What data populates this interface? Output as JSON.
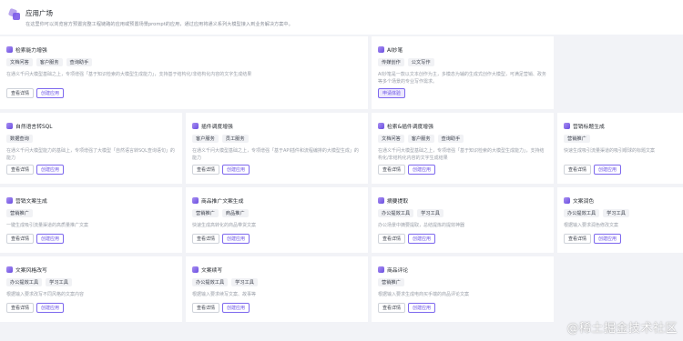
{
  "header": {
    "title": "应用广场",
    "description": "在这里你可以浏览官方预置完整工程链路的应用或预置场景prompt的应用，通过应用将通义系列大模型接入到业务解决方案中。"
  },
  "cards": [
    {
      "name": "检索能力增强",
      "tags": [
        "文档问答",
        "客户服务",
        "查询助手"
      ],
      "desc": "在通义千问大模型基础之上，专项增强「基于知识检索的大模型生成能力」，支持基于结构化/非结构化内容的文字生成结果",
      "view": "查看详情",
      "create": "创建应用"
    },
    {
      "name": "AI妙笔",
      "tags": [
        "传媒创作",
        "公文写作"
      ],
      "desc": "AI妙笔是一款以文本创作为主，多模态为辅的生成式创作大模型，可满足营销、政务等多个场景的专业写作需求。",
      "create": "申请体验"
    },
    {
      "name": "自然语言转SQL",
      "tags": [
        "数据查询"
      ],
      "desc": "在通义千问大模型能力的基础上，专项增强了大模型「自然语言转SQL查询语句」的能力",
      "view": "查看详情",
      "create": "创建应用"
    },
    {
      "name": "插件调度增强",
      "tags": [
        "客户服务",
        "员工服务"
      ],
      "desc": "在通义千问大模型基础之上，专项增强「基于API插件和流程编排的大模型生成」的能力",
      "view": "查看详情",
      "create": "创建应用"
    },
    {
      "name": "检索&插件调度增强",
      "tags": [
        "文档问答",
        "客户服务",
        "查询助手"
      ],
      "desc": "在通义千问大模型基础之上，专项增强「基于知识检索的大模型生成能力」，支持结构化/非结构化内容的文字生成结果",
      "view": "查看详情",
      "create": "创建应用"
    },
    {
      "name": "营销标题生成",
      "tags": [
        "营销推广"
      ],
      "desc": "快速生成吸引流量渠道的吸引眼球的标题文案",
      "view": "查看详情",
      "create": "创建应用"
    },
    {
      "name": "营销文案生成",
      "tags": [
        "营销推广"
      ],
      "desc": "一键生成吸引流量渠道的高质量推广文案",
      "view": "查看详情",
      "create": "创建应用"
    },
    {
      "name": "商品推广文案生成",
      "tags": [
        "营销推广",
        "商品推广"
      ],
      "desc": "快速生成高转化的商品带货文案",
      "view": "查看详情",
      "create": "创建应用"
    },
    {
      "name": "摘要提取",
      "tags": [
        "办公提效工具",
        "学习工具"
      ],
      "desc": "办公场景中摘要提取，总结提炼的提效神器",
      "view": "查看详情",
      "create": "创建应用"
    },
    {
      "name": "文案润色",
      "tags": [
        "办公提效工具",
        "学习工具"
      ],
      "desc": "根据输入要求润色修改文案",
      "view": "查看详情",
      "create": "创建应用"
    },
    {
      "name": "文案风格改写",
      "tags": [
        "办公提效工具",
        "学习工具"
      ],
      "desc": "根据输入要求改写不同风格的文案内容",
      "view": "查看详情",
      "create": "创建应用"
    },
    {
      "name": "文案续写",
      "tags": [
        "办公提效工具",
        "学习工具"
      ],
      "desc": "根据输入要求续写文案、故事等",
      "view": "查看详情",
      "create": "创建应用"
    },
    {
      "name": "商品评论",
      "tags": [
        "营销推广"
      ],
      "desc": "根据输入要求生成电商买手端的商品评论文案",
      "view": "查看详情",
      "create": "创建应用"
    }
  ],
  "watermark": "@稀土掘金技术社区"
}
